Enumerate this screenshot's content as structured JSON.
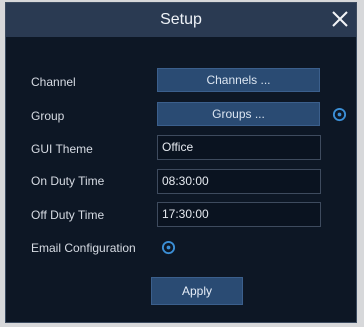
{
  "dialog": {
    "title": "Setup"
  },
  "rows": {
    "channel": {
      "label": "Channel",
      "button": "Channels ..."
    },
    "group": {
      "label": "Group",
      "button": "Groups ..."
    },
    "gui_theme": {
      "label": "GUI Theme",
      "value": "Office"
    },
    "on_duty": {
      "label": "On Duty Time",
      "value": "08:30:00"
    },
    "off_duty": {
      "label": "Off Duty Time",
      "value": "17:30:00"
    },
    "email": {
      "label": "Email Configuration"
    }
  },
  "apply_label": "Apply",
  "icons": {
    "close": "close-icon",
    "group_settings": "gear-icon",
    "email_settings": "gear-icon"
  },
  "colors": {
    "dialog_bg": "#0d1725",
    "titlebar_bg": "#2a3a52",
    "button_bg": "#2a4b73",
    "accent": "#3b8fd6"
  }
}
